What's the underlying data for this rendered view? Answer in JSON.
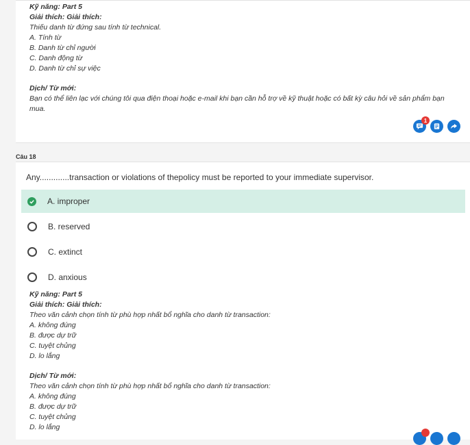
{
  "q17": {
    "skill": "Kỹ năng: Part 5",
    "expl_title": "Giải thích: Giải thích:",
    "expl_lines": [
      "Thiếu danh từ đứng sau tính từ technical.",
      "A. Tính từ",
      "B. Danh từ chỉ người",
      "C. Danh động từ",
      "D. Danh từ chỉ sự việc"
    ],
    "trans_title": "Dịch/ Từ mới:",
    "trans_text": "Bạn có thể liên lạc với chúng tôi qua điện thoại hoặc e-mail khi bạn cần hỗ trợ về kỹ thuật hoặc có bất kỳ câu hỏi về sản phẩm bạn mua.",
    "actions": [
      {
        "icon": "comment-icon",
        "badge": "1"
      },
      {
        "icon": "note-icon",
        "badge": ""
      },
      {
        "icon": "share-icon",
        "badge": ""
      }
    ]
  },
  "q18": {
    "label": "Câu 18",
    "question": "Any.............transaction or violations of thepolicy must be reported to your immediate supervisor.",
    "options": [
      {
        "label": "A. improper",
        "selected": true
      },
      {
        "label": "B. reserved",
        "selected": false
      },
      {
        "label": "C. extinct",
        "selected": false
      },
      {
        "label": "D. anxious",
        "selected": false
      }
    ],
    "skill": "Kỹ năng: Part 5",
    "expl_title": "Giải thích: Giải thích:",
    "expl_lines": [
      "Theo văn cảnh chọn tính từ phù hợp nhất bổ nghĩa cho danh từ transaction:",
      "A. không đúng",
      "B. được dự trữ",
      "C. tuyệt chủng",
      "D. lo lắng"
    ],
    "trans_title": "Dịch/ Từ mới:",
    "trans_lines": [
      "Theo văn cảnh chọn tính từ phù hợp nhất bổ nghĩa cho danh từ transaction:",
      "A. không đúng",
      "B. được dự trữ",
      "C. tuyệt chủng",
      "D. lo lắng"
    ]
  },
  "colors": {
    "accent": "#1976d2",
    "selected_bg": "#d5efe6",
    "check": "#2e9e5e",
    "badge": "#e53935"
  }
}
